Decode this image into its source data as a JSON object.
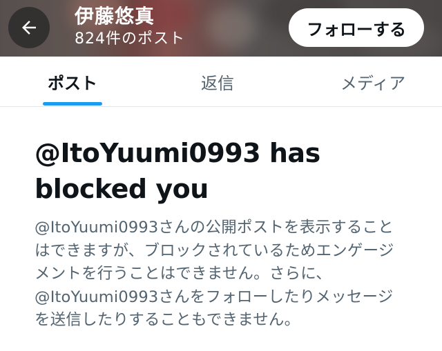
{
  "header": {
    "profile_name": "伊藤悠真",
    "post_count": "824件のポスト",
    "follow_label": "フォローする",
    "back_icon": "arrow-left-icon"
  },
  "tabs": [
    {
      "label": "ポスト",
      "active": true
    },
    {
      "label": "返信",
      "active": false
    },
    {
      "label": "メディア",
      "active": false
    }
  ],
  "message": {
    "title": "@ItoYuumi0993 has blocked you",
    "body": "@ItoYuumi0993さんの公開ポストを表示することはできますが、ブロックされているためエンゲージメントを行うことはできません。さらに、@ItoYuumi0993さんをフォローしたりメッセージを送信したりすることもできません。"
  },
  "colors": {
    "accent": "#1d9bf0",
    "text_primary": "#0f1419",
    "text_secondary": "#536471"
  }
}
